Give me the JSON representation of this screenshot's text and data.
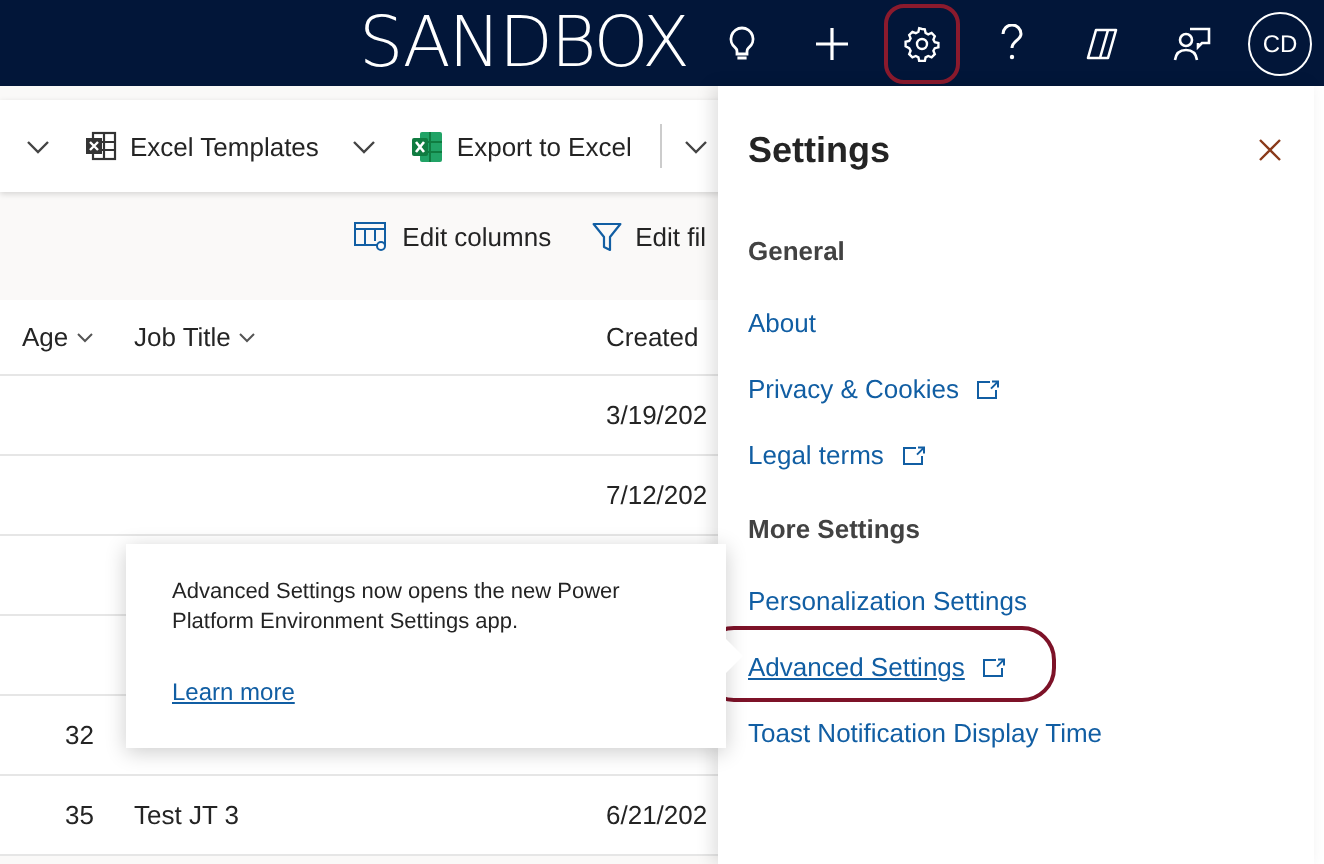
{
  "top_bar": {
    "title": "SANDBOX",
    "buttons": [
      {
        "kind": "lightbulb",
        "highlighted": false
      },
      {
        "kind": "plus",
        "highlighted": false
      },
      {
        "kind": "gear",
        "highlighted": true
      },
      {
        "kind": "help",
        "highlighted": false
      },
      {
        "kind": "copilot",
        "highlighted": false
      },
      {
        "kind": "feedback",
        "highlighted": false
      }
    ],
    "avatar": "CD"
  },
  "command_bar": [
    {
      "kind": "chevron"
    },
    {
      "kind": "templates",
      "label": "Excel Templates"
    },
    {
      "kind": "chevron"
    },
    {
      "kind": "export",
      "label": "Export to Excel"
    },
    {
      "kind": "separator"
    },
    {
      "kind": "chevron"
    }
  ],
  "view_actions": [
    {
      "kind": "columns",
      "label": "Edit columns"
    },
    {
      "kind": "filter",
      "label": "Edit fil"
    }
  ],
  "table": {
    "columns": [
      {
        "label": "Age",
        "sortable": true
      },
      {
        "label": "Job Title",
        "sortable": true
      },
      {
        "label": "Created",
        "sortable": false
      }
    ],
    "rows": [
      {
        "created": "3/19/202"
      },
      {
        "created": "7/12/202"
      },
      {},
      {},
      {
        "age": "32"
      },
      {
        "age": "35",
        "job_title": "Test JT 3",
        "created": "6/21/202"
      }
    ]
  },
  "teaching_bubble": {
    "text": "Advanced Settings now opens the new Power Platform Environment Settings app.",
    "link": "Learn more"
  },
  "settings_panel": {
    "title": "Settings",
    "sections": [
      {
        "heading": "General",
        "links": [
          {
            "label": "About",
            "external": false,
            "highlighted": false
          },
          {
            "label": "Privacy & Cookies",
            "external": true,
            "highlighted": false
          },
          {
            "label": "Legal terms",
            "external": true,
            "highlighted": false
          }
        ]
      },
      {
        "heading": "More Settings",
        "links": [
          {
            "label": "Personalization Settings",
            "external": false,
            "highlighted": false
          },
          {
            "label": "Advanced Settings",
            "external": true,
            "highlighted": true
          },
          {
            "label": "Toast Notification Display Time",
            "external": false,
            "highlighted": false
          }
        ]
      }
    ]
  }
}
